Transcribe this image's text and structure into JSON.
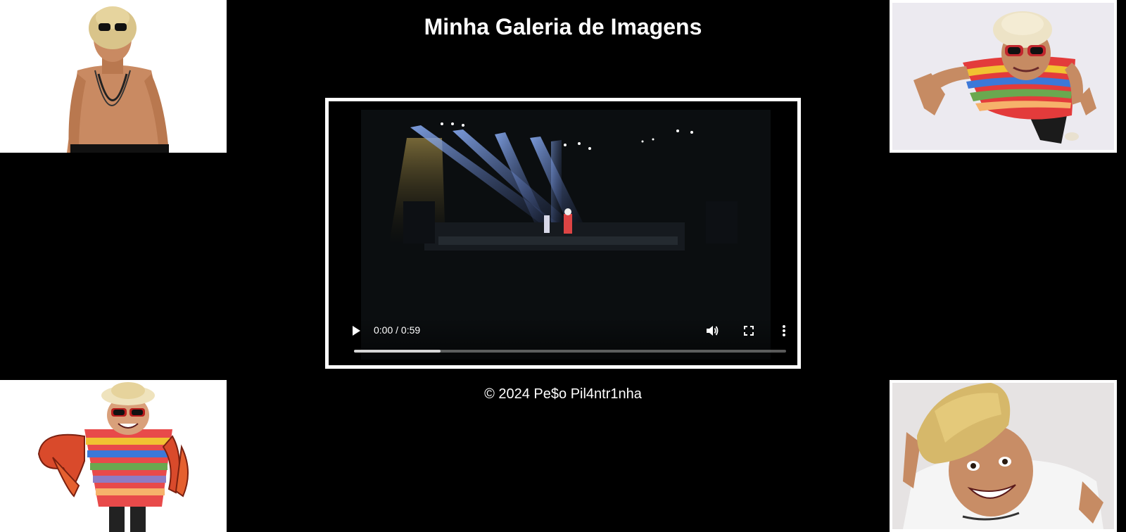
{
  "page": {
    "title": "Minha Galeria de Imagens",
    "footer": "© 2024 Pe$o Pil4ntr1nha"
  },
  "gallery": {
    "images": [
      {
        "name": "photo-top-left",
        "subject": "shirtless man with straw hat and sunglasses"
      },
      {
        "name": "photo-top-right",
        "subject": "man in striped shirt with red sunglasses looking up"
      },
      {
        "name": "photo-bottom-left",
        "subject": "cartoon man with crab claws and striped shirt"
      },
      {
        "name": "photo-bottom-right",
        "subject": "smiling man with straw hat in white shirt"
      }
    ]
  },
  "video": {
    "current_time": "0:00 / 0:59",
    "buffered_fraction": 0.2,
    "icons": [
      "play-icon",
      "volume-icon",
      "fullscreen-icon",
      "more-options-icon"
    ]
  },
  "colors": {
    "background": "#000000",
    "text": "#ffffff",
    "frame_border": "#ffffff"
  }
}
